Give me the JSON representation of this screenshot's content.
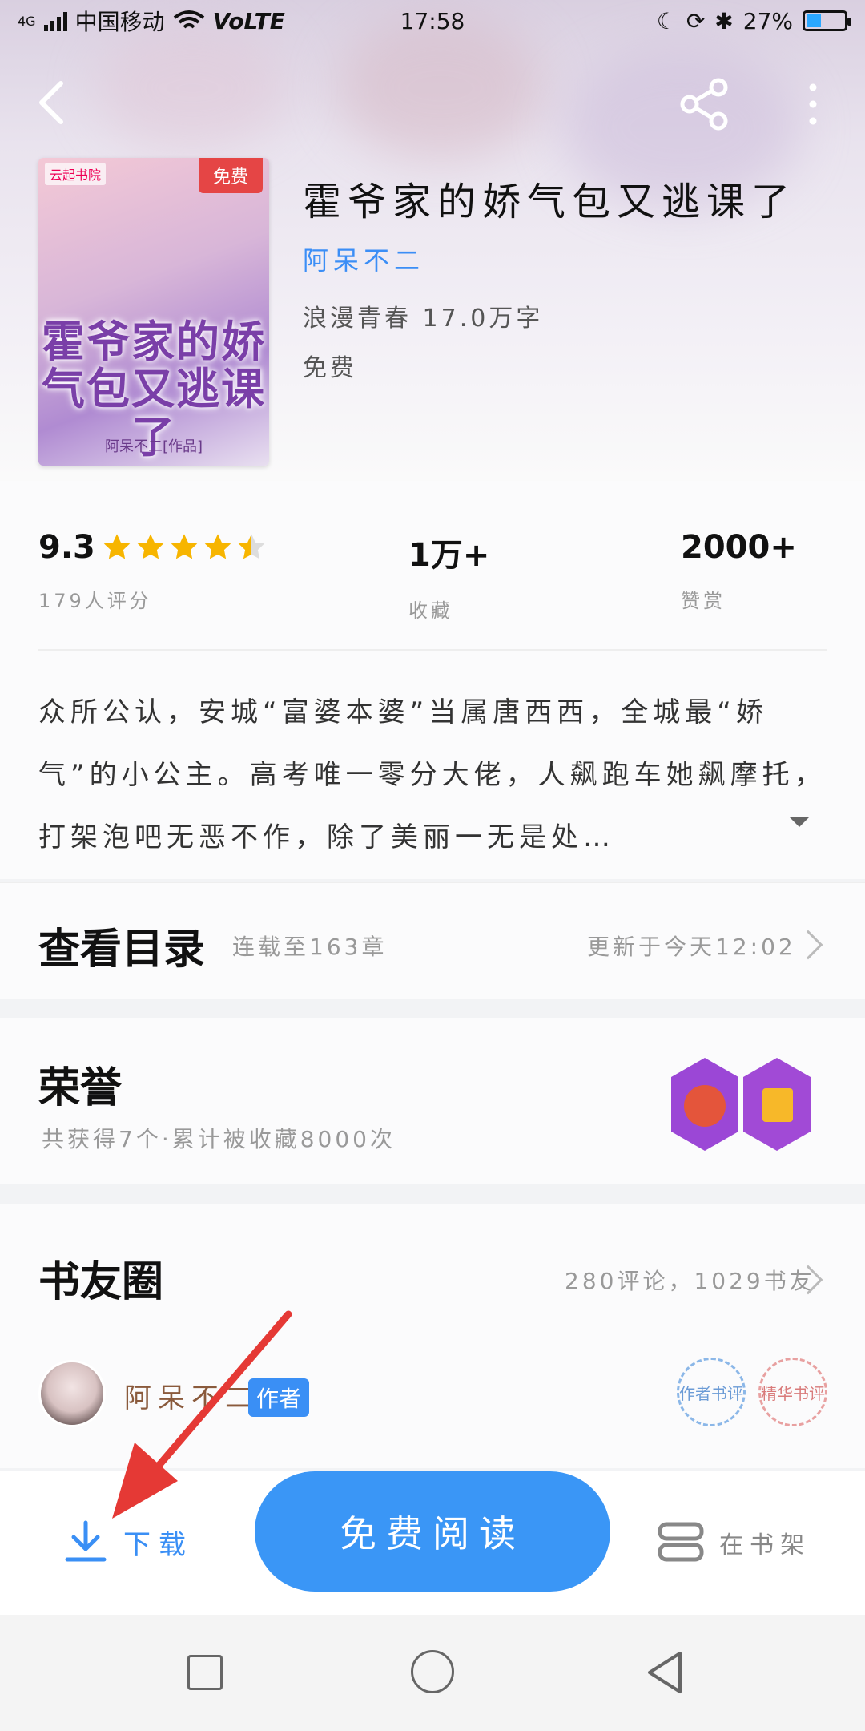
{
  "status_bar": {
    "network": "4G",
    "carrier": "中国移动",
    "volte": "VoLTE",
    "time": "17:58",
    "battery": "27%"
  },
  "book": {
    "cover_tag": "免费",
    "cover_publisher": "云起书院",
    "cover_title": "霍爷家的娇气包又逃课了",
    "cover_subtitle": "阿呆不二[作品]",
    "title": "霍爷家的娇气包又逃课了",
    "author": "阿呆不二",
    "genre_words": "浪漫青春  17.0万字",
    "price": "免费"
  },
  "stats": {
    "rating": "9.3",
    "rating_label": "179人评分",
    "rating_stars": 4.5,
    "collect_value": "1万+",
    "collect_label": "收藏",
    "reward_value": "2000+",
    "reward_label": "赞赏"
  },
  "synopsis": "众所公认，安城“富婆本婆”当属唐西西，全城最“娇气”的小公主。高考唯一零分大佬，人飙跑车她飙摩托，打架泡吧无恶不作，除了美丽一无是处…",
  "toc": {
    "title": "查看目录",
    "serial": "连载至163章",
    "updated": "更新于今天12:02"
  },
  "honor": {
    "title": "荣誉",
    "summary": "共获得7个·累计被收藏8000次"
  },
  "book_circle": {
    "title": "书友圈",
    "counts": "280评论，1029书友",
    "user_name": "阿呆不二",
    "user_badge": "作者",
    "stamp1": "作者书评",
    "stamp2": "精华书评"
  },
  "actions": {
    "download_label": "下载",
    "read_label": "免费阅读",
    "shelf_label": "在书架"
  },
  "colors": {
    "accent": "#3a96f6",
    "annotation": "#e53935"
  }
}
